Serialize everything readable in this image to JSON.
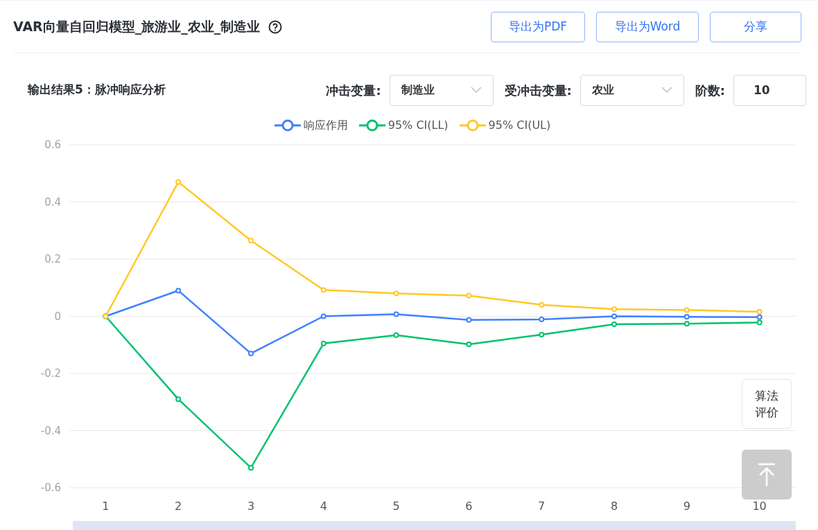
{
  "header": {
    "title": "VAR向量自回归模型_旅游业_农业_制造业",
    "buttons": [
      "导出为PDF",
      "导出为Word",
      "分享"
    ]
  },
  "controls": {
    "section_title": "输出结果5：脉冲响应分析",
    "shock_label": "冲击变量:",
    "shock_value": "制造业",
    "response_label": "受冲击变量:",
    "response_value": "农业",
    "order_label": "阶数:",
    "order_value": "10"
  },
  "chart_data": {
    "type": "line",
    "grid": true,
    "categories": [
      "1",
      "2",
      "3",
      "4",
      "5",
      "6",
      "7",
      "8",
      "9",
      "10"
    ],
    "ylim": [
      -0.6,
      0.6
    ],
    "yticks": [
      {
        "value": 0.6,
        "label": "0.6"
      },
      {
        "value": 0.4,
        "label": "0.4"
      },
      {
        "value": 0.2,
        "label": "0.2"
      },
      {
        "value": 0,
        "label": "0"
      },
      {
        "value": -0.2,
        "label": "-0.2"
      },
      {
        "value": -0.4,
        "label": "-0.4"
      },
      {
        "value": -0.6,
        "label": "-0.6"
      }
    ],
    "series": [
      {
        "name": "响应作用",
        "color": "#4080ff",
        "marker": true,
        "values": [
          0,
          0.09,
          -0.13,
          0,
          0.007,
          -0.013,
          -0.011,
          0,
          -0.002,
          -0.003
        ]
      },
      {
        "name": "95% CI(LL)",
        "color": "#00c16e",
        "marker": true,
        "values": [
          0,
          -0.29,
          -0.53,
          -0.095,
          -0.066,
          -0.098,
          -0.064,
          -0.028,
          -0.026,
          -0.022
        ]
      },
      {
        "name": "95% CI(UL)",
        "color": "#ffc827",
        "marker": true,
        "values": [
          0,
          0.47,
          0.265,
          0.092,
          0.08,
          0.072,
          0.04,
          0.025,
          0.022,
          0.016
        ]
      }
    ]
  },
  "float_buttons": {
    "evaluate": "算法评价"
  },
  "zoom_slider": {
    "level": 1
  }
}
